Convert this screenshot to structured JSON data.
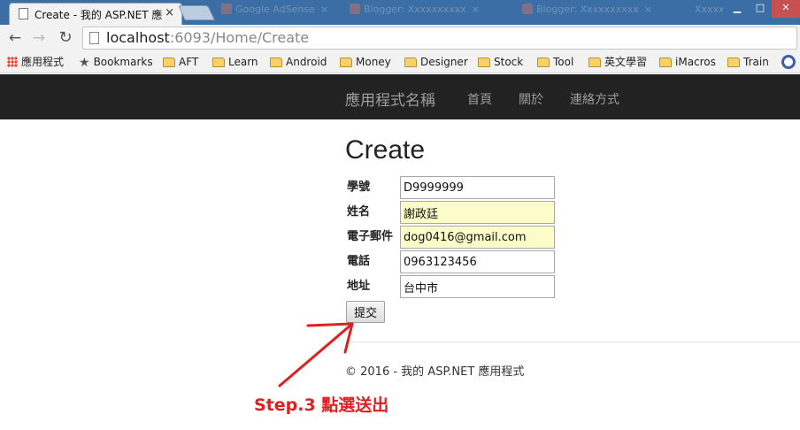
{
  "browser": {
    "active_tab_title": "Create - 我的 ASP.NET 應",
    "active_tab_close": "×",
    "background_tabs": [
      "Google AdSense",
      "Blogger: Xxxxxxxxxx",
      "Blogger: Xxxxxxxxxx",
      "Xxxxxxxxx"
    ],
    "url_host": "localhost",
    "url_rest": ":6093/Home/Create"
  },
  "bookmarks": [
    {
      "label": "應用程式",
      "icon": "apps-icon"
    },
    {
      "label": "Bookmarks",
      "icon": "star-icon"
    },
    {
      "label": "AFT",
      "icon": "folder-icon"
    },
    {
      "label": "Learn",
      "icon": "folder-icon"
    },
    {
      "label": "Android",
      "icon": "folder-icon"
    },
    {
      "label": "Money",
      "icon": "folder-icon"
    },
    {
      "label": "Designer",
      "icon": "folder-icon"
    },
    {
      "label": "Stock",
      "icon": "folder-icon"
    },
    {
      "label": "Tool",
      "icon": "folder-icon"
    },
    {
      "label": "英文學習",
      "icon": "folder-icon"
    },
    {
      "label": "iMacros",
      "icon": "folder-icon"
    },
    {
      "label": "Train",
      "icon": "folder-icon"
    }
  ],
  "navbar": {
    "brand": "應用程式名稱",
    "links": [
      "首頁",
      "關於",
      "連絡方式"
    ]
  },
  "page": {
    "title": "Create",
    "fields": [
      {
        "label": "學號",
        "value": "D9999999",
        "autofill": false
      },
      {
        "label": "姓名",
        "value": "謝政廷",
        "autofill": true
      },
      {
        "label": "電子郵件",
        "value": "dog0416@gmail.com",
        "autofill": true
      },
      {
        "label": "電話",
        "value": "0963123456",
        "autofill": false
      },
      {
        "label": "地址",
        "value": "台中市",
        "autofill": false
      }
    ],
    "submit_label": "提交",
    "footer": "© 2016 - 我的 ASP.NET 應用程式"
  },
  "annotation": {
    "text": "Step.3 點選送出",
    "color": "#e02020"
  },
  "colors": {
    "navbar_bg": "#222222",
    "navbar_text": "#9d9d9d",
    "tabstrip": "#3b6ea5",
    "autofill_bg": "#fbfcc8"
  }
}
